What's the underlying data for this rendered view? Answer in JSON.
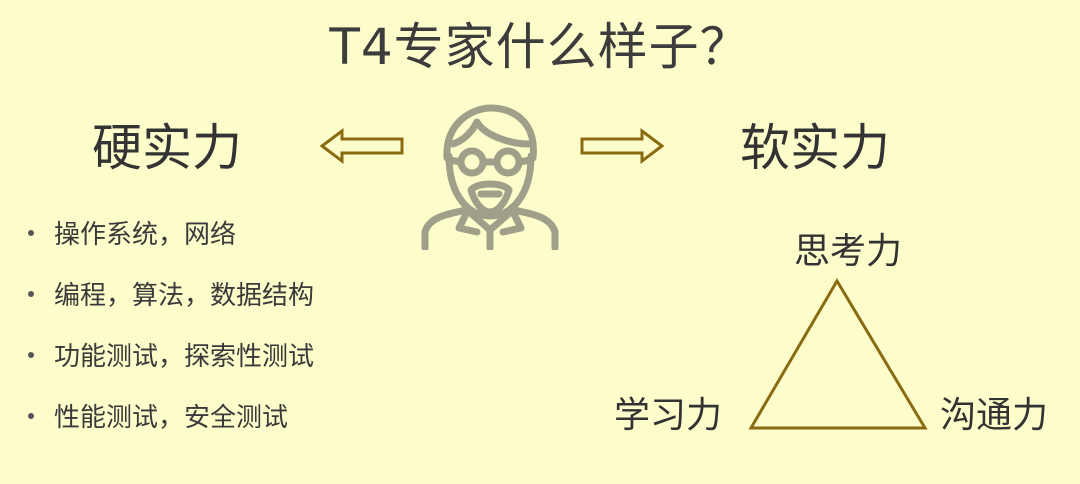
{
  "title": "T4专家什么样子？",
  "hard_power": {
    "heading": "硬实力",
    "items": [
      "操作系统，网络",
      "编程，算法，数据结构",
      "功能测试，探索性测试",
      "性能测试，安全测试"
    ]
  },
  "soft_power": {
    "heading": "软实力",
    "triangle": {
      "top": "思考力",
      "left": "学习力",
      "right": "沟通力"
    }
  },
  "icons": {
    "center": "expert-person-icon",
    "left_arrow": "arrow-left-icon",
    "right_arrow": "arrow-right-icon"
  },
  "colors": {
    "background": "#fdfdcb",
    "accent": "#8a6b12",
    "figure": "#a0a08a",
    "text": "#333333"
  }
}
